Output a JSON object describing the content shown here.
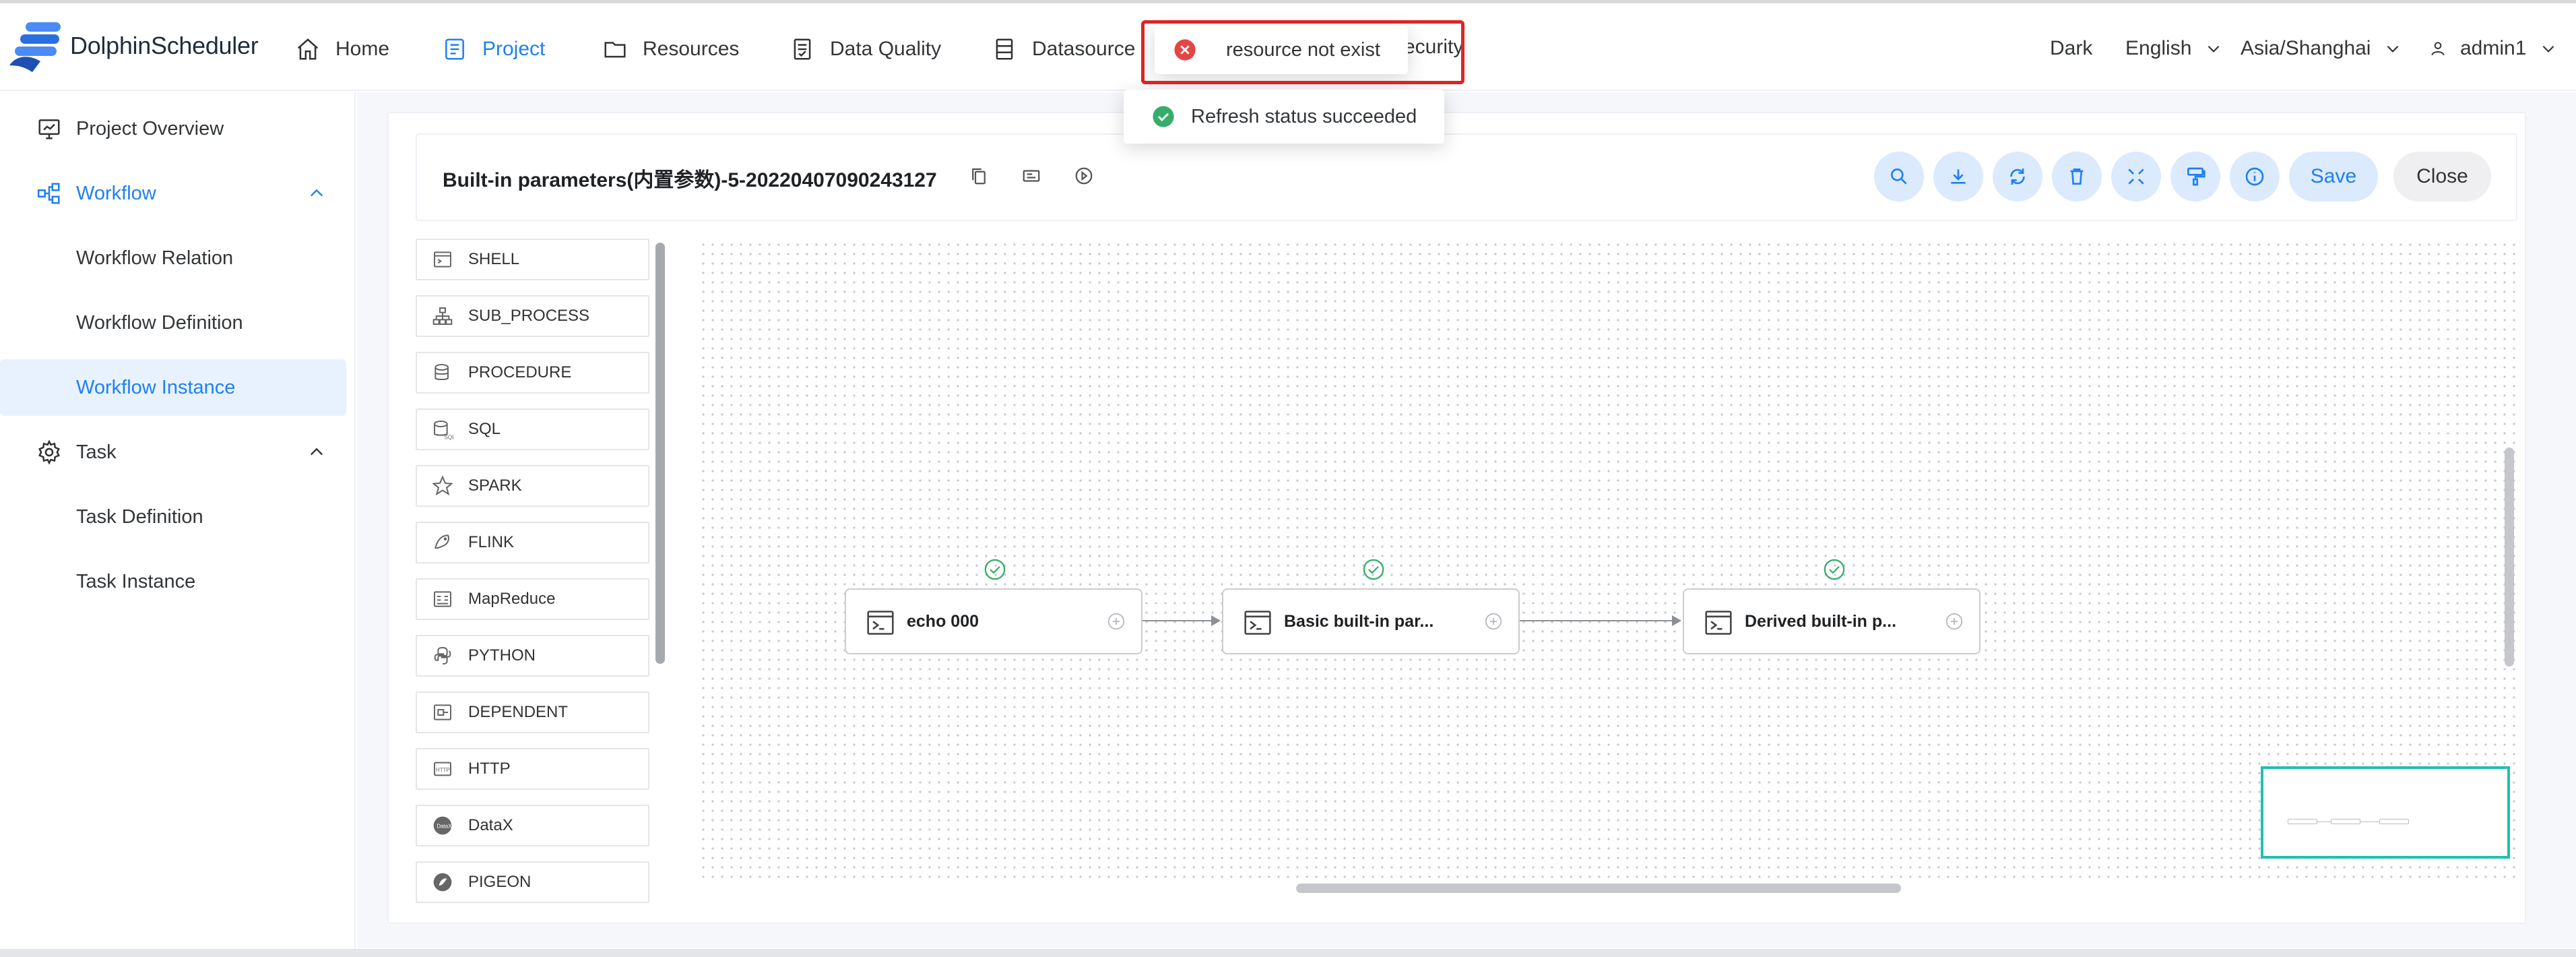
{
  "app": {
    "brand": "DolphinScheduler"
  },
  "nav": {
    "items": [
      {
        "label": "Home",
        "icon": "home-icon"
      },
      {
        "label": "Project",
        "icon": "project-icon",
        "active": true
      },
      {
        "label": "Resources",
        "icon": "folder-icon"
      },
      {
        "label": "Data Quality",
        "icon": "data-quality-icon"
      },
      {
        "label": "Datasource",
        "icon": "datasource-icon"
      }
    ],
    "hidden_tail": "ecurity"
  },
  "header_right": {
    "theme": "Dark",
    "language": "English",
    "timezone": "Asia/Shanghai",
    "user": "admin1"
  },
  "sidebar": {
    "items": [
      {
        "label": "Project Overview",
        "icon": "overview-icon"
      },
      {
        "label": "Workflow",
        "icon": "workflow-icon",
        "expanded": true
      },
      {
        "label": "Workflow Relation"
      },
      {
        "label": "Workflow Definition"
      },
      {
        "label": "Workflow Instance",
        "selected": true
      },
      {
        "label": "Task",
        "icon": "gear-icon",
        "expanded": true
      },
      {
        "label": "Task Definition"
      },
      {
        "label": "Task Instance"
      }
    ]
  },
  "workflow": {
    "title": "Built-in parameters(内置参数)-5-20220407090243127",
    "save_label": "Save",
    "close_label": "Close"
  },
  "toolbar_icons": [
    "search-icon",
    "download-icon",
    "refresh-icon",
    "delete-icon",
    "fullscreen-icon",
    "format-icon",
    "info-icon"
  ],
  "palette": {
    "items": [
      {
        "label": "SHELL",
        "icon": "shell-icon"
      },
      {
        "label": "SUB_PROCESS",
        "icon": "sub-process-icon"
      },
      {
        "label": "PROCEDURE",
        "icon": "procedure-icon"
      },
      {
        "label": "SQL",
        "icon": "sql-icon"
      },
      {
        "label": "SPARK",
        "icon": "spark-icon"
      },
      {
        "label": "FLINK",
        "icon": "flink-icon"
      },
      {
        "label": "MapReduce",
        "icon": "mapreduce-icon"
      },
      {
        "label": "PYTHON",
        "icon": "python-icon"
      },
      {
        "label": "DEPENDENT",
        "icon": "dependent-icon"
      },
      {
        "label": "HTTP",
        "icon": "http-icon"
      },
      {
        "label": "DataX",
        "icon": "datax-icon"
      },
      {
        "label": "PIGEON",
        "icon": "pigeon-icon"
      }
    ]
  },
  "dag": {
    "nodes": [
      {
        "label": "echo 000",
        "status": "success"
      },
      {
        "label": "Basic built-in par...",
        "status": "success"
      },
      {
        "label": "Derived built-in p...",
        "status": "success"
      }
    ]
  },
  "toasts": {
    "error": {
      "text": "resource not exist",
      "color": "#e54545"
    },
    "success": {
      "text": "Refresh status succeeded",
      "color": "#36ad6a"
    }
  },
  "colors": {
    "primary": "#2080f0",
    "highlight": "#e02424",
    "minimap": "#21c0b0"
  }
}
